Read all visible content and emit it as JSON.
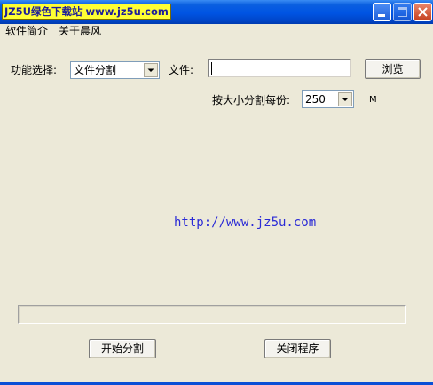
{
  "window": {
    "watermark_text": "JZ5U绿色下载站 www.jz5u.com"
  },
  "menu": {
    "items": [
      "软件简介",
      "关于晨风"
    ]
  },
  "function_select": {
    "label": "功能选择:",
    "selected": "文件分割"
  },
  "file": {
    "label": "文件:",
    "value": "",
    "browse_label": "浏览"
  },
  "split_size": {
    "label": "按大小分割每份:",
    "selected": "250",
    "unit": "M"
  },
  "website": "http://www.jz5u.com",
  "progress": {
    "fraction": 0
  },
  "buttons": {
    "start_label": "开始分割",
    "close_label": "关闭程序"
  },
  "colors": {
    "titlebar": "#0054E3",
    "face": "#ECE9D8",
    "link": "#2B2BD6",
    "watermark_bg": "#FFFF33"
  }
}
